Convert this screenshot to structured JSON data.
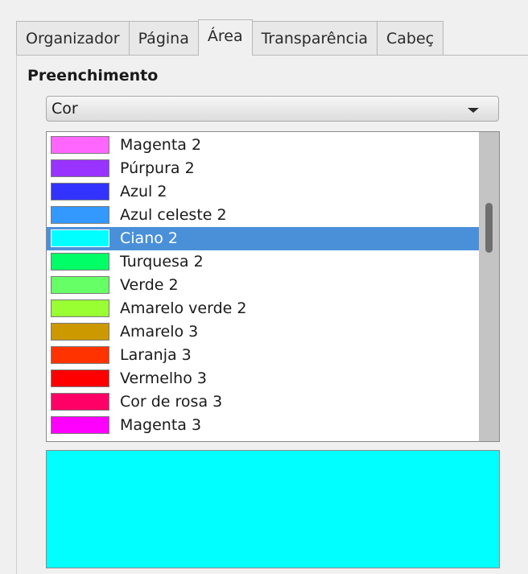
{
  "tabs": [
    {
      "label": "Organizador",
      "active": false
    },
    {
      "label": "Página",
      "active": false
    },
    {
      "label": "Área",
      "active": true
    },
    {
      "label": "Transparência",
      "active": false
    },
    {
      "label": "Cabeç",
      "active": false
    }
  ],
  "section": {
    "title": "Preenchimento"
  },
  "fill_type": {
    "selected": "Cor",
    "icon": "chevron-down-icon"
  },
  "colors": [
    {
      "label": "Magenta 2",
      "color": "#ff66ff"
    },
    {
      "label": "Púrpura 2",
      "color": "#9933ff"
    },
    {
      "label": "Azul 2",
      "color": "#3333ff"
    },
    {
      "label": "Azul celeste 2",
      "color": "#3399ff"
    },
    {
      "label": "Ciano 2",
      "color": "#00ffff",
      "selected": true
    },
    {
      "label": "Turquesa 2",
      "color": "#00ff66"
    },
    {
      "label": "Verde 2",
      "color": "#66ff66"
    },
    {
      "label": "Amarelo verde 2",
      "color": "#99ff33"
    },
    {
      "label": "Amarelo 3",
      "color": "#cc9900"
    },
    {
      "label": "Laranja 3",
      "color": "#ff3300"
    },
    {
      "label": "Vermelho 3",
      "color": "#ff0000"
    },
    {
      "label": "Cor de rosa 3",
      "color": "#ff0066"
    },
    {
      "label": "Magenta 3",
      "color": "#ff00ff"
    }
  ],
  "preview": {
    "color": "#00ffff"
  },
  "theme": {
    "selection": "#4a90d9"
  }
}
